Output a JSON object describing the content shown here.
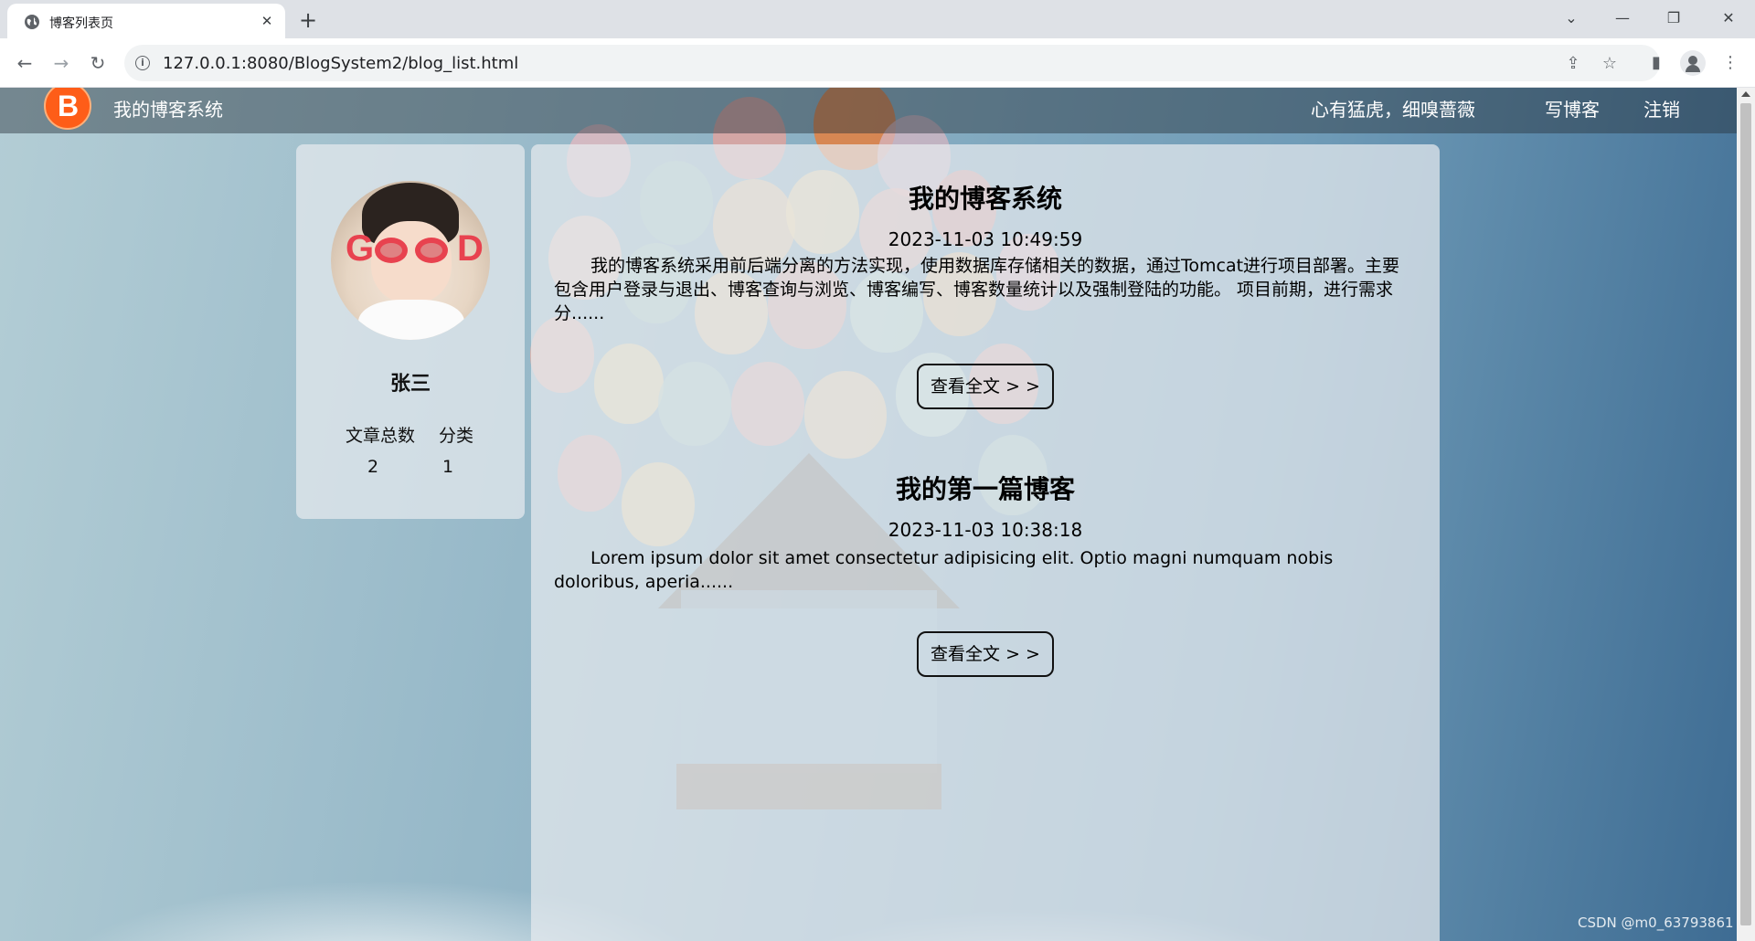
{
  "browser": {
    "tab_title": "博客列表页",
    "url": "127.0.0.1:8080/BlogSystem2/blog_list.html",
    "icons": {
      "favicon": "globe-icon",
      "tab_close": "close-icon",
      "new_tab": "plus-icon",
      "back": "arrow-left-icon",
      "forward": "arrow-right-icon",
      "reload": "reload-icon",
      "site_info": "info-icon",
      "share": "share-icon",
      "bookmark": "star-icon",
      "side_panel": "side-panel-icon",
      "profile": "profile-icon",
      "menu": "kebab-menu-icon"
    }
  },
  "nav": {
    "logo_letter": "B",
    "title": "我的博客系统",
    "links": [
      "心有猛虎，细嗅蔷薇",
      "写博客",
      "注销"
    ]
  },
  "profile_card": {
    "username": "张三",
    "stats": [
      {
        "label": "文章总数",
        "value": "2"
      },
      {
        "label": "分类",
        "value": "1"
      }
    ]
  },
  "blogs": [
    {
      "title": "我的博客系统",
      "date": "2023-11-03 10:49:59",
      "desc": "我的博客系统采用前后端分离的方法实现，使用数据库存储相关的数据，通过Tomcat进行项目部署。主要包含用户登录与退出、博客查询与浏览、博客编写、博客数量统计以及强制登陆的功能。 项目前期，进行需求分......",
      "button": "查看全文 > >"
    },
    {
      "title": "我的第一篇博客",
      "date": "2023-11-03 10:38:18",
      "desc": "Lorem ipsum dolor sit amet consectetur adipisicing elit. Optio magni numquam nobis doloribus, aperia......",
      "button": "查看全文 > >"
    }
  ],
  "watermark": "CSDN @m0_63793861",
  "colors": {
    "logo": "#fe5d18",
    "accent_glasses": "#e8424f"
  }
}
